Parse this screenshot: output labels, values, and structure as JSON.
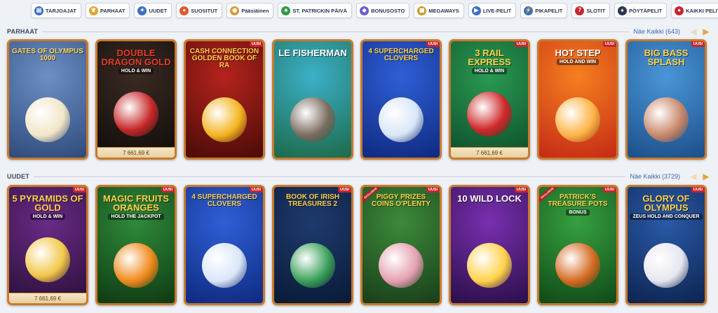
{
  "categories": [
    {
      "id": "tarjoajat",
      "label": "TARJOAJAT",
      "icon": "providers-icon",
      "glyph": "▤",
      "color": "#3a6fc4"
    },
    {
      "id": "parhaat",
      "label": "PARHAAT",
      "icon": "crown-icon",
      "glyph": "♛",
      "color": "#e0a72e"
    },
    {
      "id": "uudet",
      "label": "UUDET",
      "icon": "new-icon",
      "glyph": "✦",
      "color": "#3a6fc4"
    },
    {
      "id": "suositut",
      "label": "SUOSITUT",
      "icon": "flame-icon",
      "glyph": "●",
      "color": "#e2572c"
    },
    {
      "id": "paasiainen",
      "label": "Pääsiäinen",
      "icon": "easter-egg-icon",
      "glyph": "◉",
      "color": "#d69a3b"
    },
    {
      "id": "st-patrick",
      "label": "ST. PATRICKIN PÄIVÄ",
      "icon": "clover-icon",
      "glyph": "♣",
      "color": "#2e9a44"
    },
    {
      "id": "bonusosto",
      "label": "BONUSOSTO",
      "icon": "bonus-icon",
      "glyph": "◆",
      "color": "#6a5ad0"
    },
    {
      "id": "megaways",
      "label": "MEGAWAYS",
      "icon": "megaways-icon",
      "glyph": "▦",
      "color": "#c79a22"
    },
    {
      "id": "live-pelit",
      "label": "LIVE-PELIT",
      "icon": "live-icon",
      "glyph": "▶",
      "color": "#3a6fc4"
    },
    {
      "id": "pikapelit",
      "label": "PIKAPELIT",
      "icon": "instant-icon",
      "glyph": "⚡",
      "color": "#3a6fc4"
    },
    {
      "id": "slotit",
      "label": "SLOTIT",
      "icon": "slots-icon",
      "glyph": "7",
      "color": "#c6262e"
    },
    {
      "id": "poytapelit",
      "label": "PÖYTÄPELIT",
      "icon": "table-games-icon",
      "glyph": "♠",
      "color": "#2b3550"
    },
    {
      "id": "kaikki-pelit",
      "label": "KAIKKI PELIT",
      "icon": "cherries-icon",
      "glyph": "●",
      "color": "#c6262e"
    }
  ],
  "sections": [
    {
      "title": "PARHAAT",
      "more_label": "Näe Kaikki (643)",
      "games": [
        {
          "name": "GATES of OLYMPUS 1000",
          "sub": "",
          "badge": "",
          "jackpot": "",
          "colors": [
            "#6c8fc4",
            "#2f4b7c"
          ],
          "text": "#ffd761",
          "orb": "#f2e6c8"
        },
        {
          "name": "DOUBLE DRAGON GOLD",
          "sub": "HOLD & WIN",
          "badge": "",
          "jackpot": "7 661,69 €",
          "colors": [
            "#3a2a22",
            "#100c0a"
          ],
          "text": "#e23b2c",
          "orb": "#c8282a"
        },
        {
          "name": "CASH CONNECTION GOLDEN BOOK of RA",
          "sub": "",
          "badge": "UUSI",
          "jackpot": "",
          "colors": [
            "#b5231c",
            "#4b0b08"
          ],
          "text": "#ffd14a",
          "orb": "#f4b421"
        },
        {
          "name": "LE FISHERMAN",
          "sub": "",
          "badge": "",
          "jackpot": "",
          "colors": [
            "#3cb0c9",
            "#1c6a4a"
          ],
          "text": "#ffffff",
          "orb": "#7a6c5e"
        },
        {
          "name": "4 SUPERCHARGED CLOVERS",
          "sub": "",
          "badge": "UUSI",
          "jackpot": "",
          "colors": [
            "#2f5fd6",
            "#0f2a80"
          ],
          "text": "#ffd24a",
          "orb": "#d9e6f8"
        },
        {
          "name": "3 RAIL EXPRESS",
          "sub": "HOLD & WIN",
          "badge": "UUSI",
          "jackpot": "7 661,69 €",
          "colors": [
            "#2a9a52",
            "#0d4d2a"
          ],
          "text": "#ffd24a",
          "orb": "#d0262a"
        },
        {
          "name": "HOT STEP",
          "sub": "HOLD AND WIN",
          "badge": "UUSI",
          "jackpot": "",
          "colors": [
            "#f5801f",
            "#c52a16"
          ],
          "text": "#ffffff",
          "orb": "#ffb347"
        },
        {
          "name": "BIG BASS SPLASH",
          "sub": "",
          "badge": "UUSI",
          "jackpot": "",
          "colors": [
            "#4a96d8",
            "#1c4f8a"
          ],
          "text": "#ffd24a",
          "orb": "#c8876a"
        }
      ]
    },
    {
      "title": "UUDET",
      "more_label": "Näe Kaikki (3729)",
      "games": [
        {
          "name": "5 PYRAMIDS OF GOLD",
          "sub": "HOLD & WIN",
          "badge": "UUSI",
          "jackpot": "7 661,69 €",
          "colors": [
            "#6a2a88",
            "#2a1038"
          ],
          "text": "#ffd24a",
          "orb": "#f2c84a"
        },
        {
          "name": "Magic Fruits ORANGES",
          "sub": "HOLD THE JACKPOT",
          "badge": "UUSI",
          "jackpot": "",
          "colors": [
            "#2f8a3a",
            "#0f3a14"
          ],
          "text": "#ffd24a",
          "orb": "#f08a1c"
        },
        {
          "name": "4 SUPERCHARGED CLOVERS",
          "sub": "",
          "badge": "UUSI",
          "jackpot": "",
          "colors": [
            "#2f5fd6",
            "#0f2a80"
          ],
          "text": "#ffd24a",
          "orb": "#d9e6f8"
        },
        {
          "name": "BOOK OF IRISH TREASURES 2",
          "sub": "",
          "badge": "UUSI",
          "jackpot": "",
          "colors": [
            "#1e3a6e",
            "#0a1a36"
          ],
          "text": "#ffd24a",
          "orb": "#3aa05a"
        },
        {
          "name": "PIGGY PRIZES COINS O'Plenty",
          "sub": "",
          "badge": "UUSI",
          "jackpot": "",
          "colors": [
            "#3c8a3a",
            "#1a3e1a"
          ],
          "text": "#ffd24a",
          "orb": "#e5a0b0"
        },
        {
          "name": "10 WILD LOCK",
          "sub": "",
          "badge": "UUSI",
          "jackpot": "",
          "colors": [
            "#7a2fb0",
            "#2a0f48"
          ],
          "text": "#ffffff",
          "orb": "#ffd24a"
        },
        {
          "name": "Patrick's TREASURE POTS",
          "sub": "BONUS",
          "badge": "UUSI",
          "jackpot": "",
          "colors": [
            "#36a040",
            "#104a18"
          ],
          "text": "#ffd24a",
          "orb": "#d66a22"
        },
        {
          "name": "GLORY OF OLYMPUS",
          "sub": "ZEUS HOLD AND CONQUER",
          "badge": "UUSI",
          "jackpot": "",
          "colors": [
            "#2a5aa8",
            "#0d2450"
          ],
          "text": "#ffd24a",
          "orb": "#e6e6f0"
        }
      ]
    }
  ],
  "badges": {
    "new": "UUSI",
    "exclusive": "EXCLUSIVE"
  },
  "exclusive_tiles": [
    "1.4",
    "1.6"
  ]
}
